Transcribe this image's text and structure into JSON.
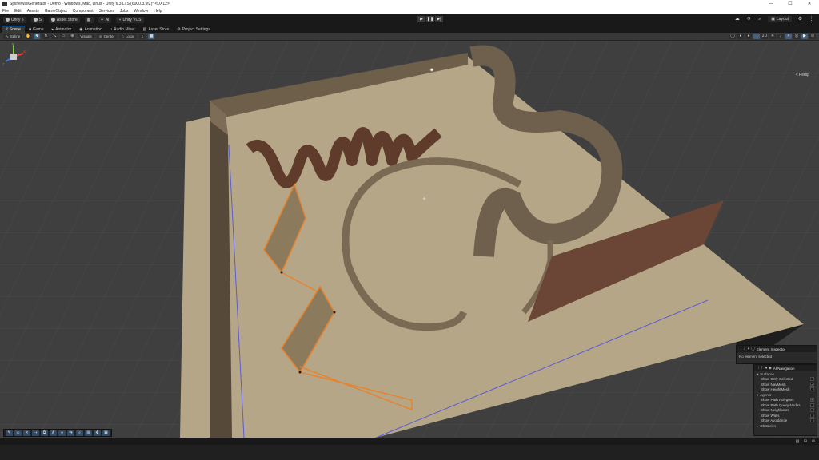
{
  "window": {
    "title": "SplineWallGenerator - Demo - Windows, Mac, Linux - Unity 6.3 LTS (6000.3.5f2)* <DX12>",
    "controls": [
      "—",
      "☐",
      "✕"
    ]
  },
  "menu": [
    "File",
    "Edit",
    "Assets",
    "GameObject",
    "Component",
    "Services",
    "Jobs",
    "Window",
    "Help"
  ],
  "toolbar": {
    "account": "Unity 6",
    "s_label": "S",
    "asset_store": "Asset Store",
    "ai": "AI",
    "vcs": "Unity VCS",
    "play_buttons": [
      "▶",
      "❚❚",
      "▶|"
    ],
    "layout": "Layout"
  },
  "tabs": [
    {
      "icon": "#",
      "label": "Scene"
    },
    {
      "icon": "■",
      "label": "Game"
    },
    {
      "icon": "▸",
      "label": "Animator"
    },
    {
      "icon": "◉",
      "label": "Animation"
    },
    {
      "icon": "♪",
      "label": "Audio Mixer"
    },
    {
      "icon": "▤",
      "label": "Asset Store"
    },
    {
      "icon": "⚙",
      "label": "Project Settings"
    }
  ],
  "scene_toolbar": {
    "tool_context": "Spline",
    "visuals": "Visuals",
    "pivot": "Center",
    "space": "Local",
    "snap_value": "1"
  },
  "viewport": {
    "perspective_label": "< Persp",
    "gizmo_axes": [
      "x",
      "y",
      "z"
    ]
  },
  "element_inspector": {
    "title": "Element Inspector",
    "body": "No element selected"
  },
  "ai_navigation": {
    "title": "AI Navigation",
    "sections": [
      {
        "label": "Surfaces",
        "items": [
          {
            "label": "Show Only Selected",
            "checked": false
          },
          {
            "label": "Show NavMesh",
            "checked": true
          },
          {
            "label": "Show HeightMesh",
            "checked": false
          }
        ]
      },
      {
        "label": "Agents",
        "items": [
          {
            "label": "Show Path Polygons",
            "checked": true
          },
          {
            "label": "Show Path Query Nodes",
            "checked": false
          },
          {
            "label": "Show Neighbours",
            "checked": false
          },
          {
            "label": "Show Walls",
            "checked": false
          },
          {
            "label": "Show Avoidance",
            "checked": false
          }
        ]
      },
      {
        "label": "Obstacles",
        "items": []
      }
    ]
  },
  "colors": {
    "ground": "#b5a687",
    "wall_stone": "#7a6a54",
    "wall_wood": "#6b4636",
    "selection": "#e8822c",
    "grid_bg": "#3f3f3f"
  }
}
